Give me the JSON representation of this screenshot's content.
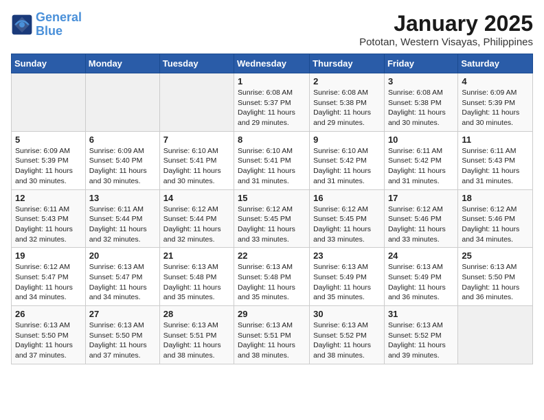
{
  "logo": {
    "line1": "General",
    "line2": "Blue"
  },
  "title": "January 2025",
  "location": "Pototan, Western Visayas, Philippines",
  "weekdays": [
    "Sunday",
    "Monday",
    "Tuesday",
    "Wednesday",
    "Thursday",
    "Friday",
    "Saturday"
  ],
  "weeks": [
    [
      {
        "day": "",
        "info": ""
      },
      {
        "day": "",
        "info": ""
      },
      {
        "day": "",
        "info": ""
      },
      {
        "day": "1",
        "info": "Sunrise: 6:08 AM\nSunset: 5:37 PM\nDaylight: 11 hours and 29 minutes."
      },
      {
        "day": "2",
        "info": "Sunrise: 6:08 AM\nSunset: 5:38 PM\nDaylight: 11 hours and 29 minutes."
      },
      {
        "day": "3",
        "info": "Sunrise: 6:08 AM\nSunset: 5:38 PM\nDaylight: 11 hours and 30 minutes."
      },
      {
        "day": "4",
        "info": "Sunrise: 6:09 AM\nSunset: 5:39 PM\nDaylight: 11 hours and 30 minutes."
      }
    ],
    [
      {
        "day": "5",
        "info": "Sunrise: 6:09 AM\nSunset: 5:39 PM\nDaylight: 11 hours and 30 minutes."
      },
      {
        "day": "6",
        "info": "Sunrise: 6:09 AM\nSunset: 5:40 PM\nDaylight: 11 hours and 30 minutes."
      },
      {
        "day": "7",
        "info": "Sunrise: 6:10 AM\nSunset: 5:41 PM\nDaylight: 11 hours and 30 minutes."
      },
      {
        "day": "8",
        "info": "Sunrise: 6:10 AM\nSunset: 5:41 PM\nDaylight: 11 hours and 31 minutes."
      },
      {
        "day": "9",
        "info": "Sunrise: 6:10 AM\nSunset: 5:42 PM\nDaylight: 11 hours and 31 minutes."
      },
      {
        "day": "10",
        "info": "Sunrise: 6:11 AM\nSunset: 5:42 PM\nDaylight: 11 hours and 31 minutes."
      },
      {
        "day": "11",
        "info": "Sunrise: 6:11 AM\nSunset: 5:43 PM\nDaylight: 11 hours and 31 minutes."
      }
    ],
    [
      {
        "day": "12",
        "info": "Sunrise: 6:11 AM\nSunset: 5:43 PM\nDaylight: 11 hours and 32 minutes."
      },
      {
        "day": "13",
        "info": "Sunrise: 6:11 AM\nSunset: 5:44 PM\nDaylight: 11 hours and 32 minutes."
      },
      {
        "day": "14",
        "info": "Sunrise: 6:12 AM\nSunset: 5:44 PM\nDaylight: 11 hours and 32 minutes."
      },
      {
        "day": "15",
        "info": "Sunrise: 6:12 AM\nSunset: 5:45 PM\nDaylight: 11 hours and 33 minutes."
      },
      {
        "day": "16",
        "info": "Sunrise: 6:12 AM\nSunset: 5:45 PM\nDaylight: 11 hours and 33 minutes."
      },
      {
        "day": "17",
        "info": "Sunrise: 6:12 AM\nSunset: 5:46 PM\nDaylight: 11 hours and 33 minutes."
      },
      {
        "day": "18",
        "info": "Sunrise: 6:12 AM\nSunset: 5:46 PM\nDaylight: 11 hours and 34 minutes."
      }
    ],
    [
      {
        "day": "19",
        "info": "Sunrise: 6:12 AM\nSunset: 5:47 PM\nDaylight: 11 hours and 34 minutes."
      },
      {
        "day": "20",
        "info": "Sunrise: 6:13 AM\nSunset: 5:47 PM\nDaylight: 11 hours and 34 minutes."
      },
      {
        "day": "21",
        "info": "Sunrise: 6:13 AM\nSunset: 5:48 PM\nDaylight: 11 hours and 35 minutes."
      },
      {
        "day": "22",
        "info": "Sunrise: 6:13 AM\nSunset: 5:48 PM\nDaylight: 11 hours and 35 minutes."
      },
      {
        "day": "23",
        "info": "Sunrise: 6:13 AM\nSunset: 5:49 PM\nDaylight: 11 hours and 35 minutes."
      },
      {
        "day": "24",
        "info": "Sunrise: 6:13 AM\nSunset: 5:49 PM\nDaylight: 11 hours and 36 minutes."
      },
      {
        "day": "25",
        "info": "Sunrise: 6:13 AM\nSunset: 5:50 PM\nDaylight: 11 hours and 36 minutes."
      }
    ],
    [
      {
        "day": "26",
        "info": "Sunrise: 6:13 AM\nSunset: 5:50 PM\nDaylight: 11 hours and 37 minutes."
      },
      {
        "day": "27",
        "info": "Sunrise: 6:13 AM\nSunset: 5:50 PM\nDaylight: 11 hours and 37 minutes."
      },
      {
        "day": "28",
        "info": "Sunrise: 6:13 AM\nSunset: 5:51 PM\nDaylight: 11 hours and 38 minutes."
      },
      {
        "day": "29",
        "info": "Sunrise: 6:13 AM\nSunset: 5:51 PM\nDaylight: 11 hours and 38 minutes."
      },
      {
        "day": "30",
        "info": "Sunrise: 6:13 AM\nSunset: 5:52 PM\nDaylight: 11 hours and 38 minutes."
      },
      {
        "day": "31",
        "info": "Sunrise: 6:13 AM\nSunset: 5:52 PM\nDaylight: 11 hours and 39 minutes."
      },
      {
        "day": "",
        "info": ""
      }
    ]
  ]
}
